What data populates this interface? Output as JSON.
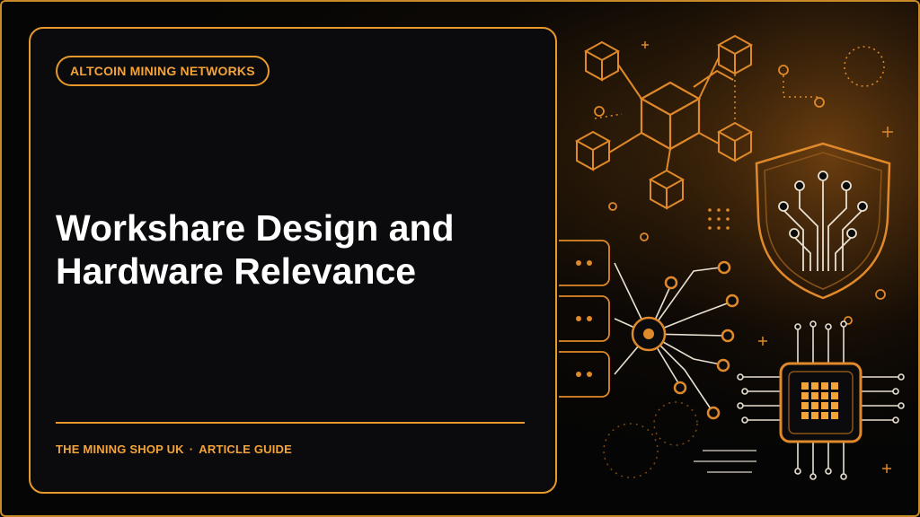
{
  "card": {
    "category_label": "ALTCOIN MINING NETWORKS",
    "title_line1": "Workshare Design and",
    "title_line2": "Hardware Relevance",
    "footer_brand": "THE MINING SHOP UK",
    "footer_separator": "·",
    "footer_section": "ARTICLE GUIDE"
  },
  "illustration": {
    "icons": [
      "blockchain-cubes-icon",
      "shield-circuit-icon",
      "server-rack-icon",
      "network-hub-icon",
      "cpu-chip-icon"
    ]
  },
  "colors": {
    "accent": "#e79a2b",
    "text": "#ffffff",
    "background": "#0b0b0d"
  }
}
